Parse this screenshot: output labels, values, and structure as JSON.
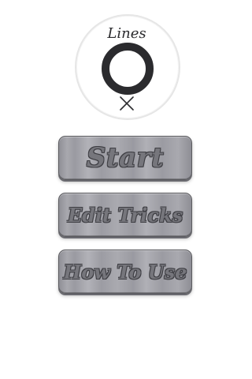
{
  "app": {
    "logo_text": "Lines"
  },
  "menu": {
    "start_label": "Start",
    "edit_tricks_label": "Edit Tricks",
    "how_to_use_label": "How To Use"
  },
  "colors": {
    "button_face": "#a1a1a8",
    "button_border": "#5a5a5e",
    "label_fill": "#76767c",
    "label_outline": "#3f3f44",
    "logo_ring": "#2b2b2e"
  },
  "icons": [
    "lines-logo",
    "ring-icon",
    "x-icon"
  ]
}
